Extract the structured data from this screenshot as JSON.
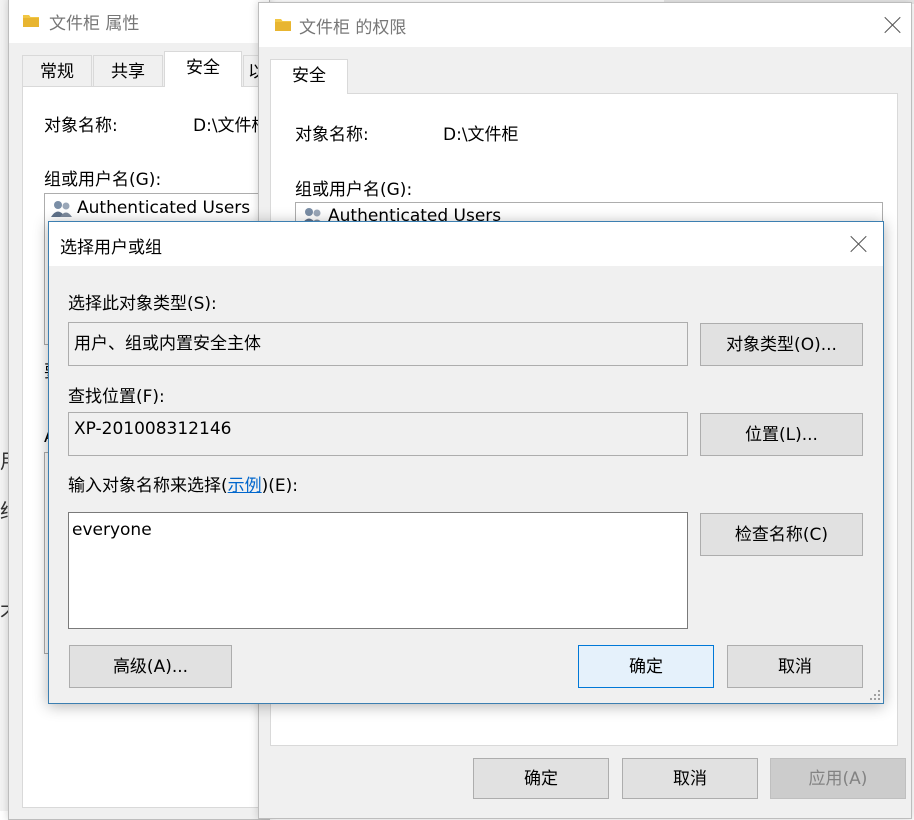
{
  "properties_window": {
    "title": "文件柜 属性",
    "tabs": [
      "常规",
      "共享",
      "安全",
      "以"
    ],
    "object_name_label": "对象名称:",
    "object_name_value": "D:\\文件柜",
    "group_label": "组或用户名(G):",
    "users": [
      "Authenticated Users"
    ]
  },
  "permissions_window": {
    "title": "文件柜 的权限",
    "tab": "安全",
    "object_name_label": "对象名称:",
    "object_name_value": "D:\\文件柜",
    "group_label": "组或用户名(G):",
    "users": [
      "Authenticated Users"
    ],
    "ok_label": "确定",
    "cancel_label": "取消",
    "apply_label": "应用(A)"
  },
  "select_dialog": {
    "title": "选择用户或组",
    "object_type_label": "选择此对象类型(S):",
    "object_type_value": "用户、组或内置安全主体",
    "object_type_button": "对象类型(O)...",
    "location_label": "查找位置(F):",
    "location_value": "XP-201008312146",
    "location_button": "位置(L)...",
    "enter_label_prefix": "输入对象名称来选择(",
    "enter_label_link": "示例",
    "enter_label_suffix": ")(E):",
    "enter_value": "everyone",
    "check_names_button": "检查名称(C)",
    "advanced_button": "高级(A)...",
    "ok_label": "确定",
    "cancel_label": "取消"
  },
  "background_fragments": [
    "要",
    "A",
    "值",
    "用",
    "绉",
    "才"
  ],
  "colors": {
    "link": "#0066cc",
    "primary_border": "#0078d7",
    "folder": "#f2c744"
  }
}
